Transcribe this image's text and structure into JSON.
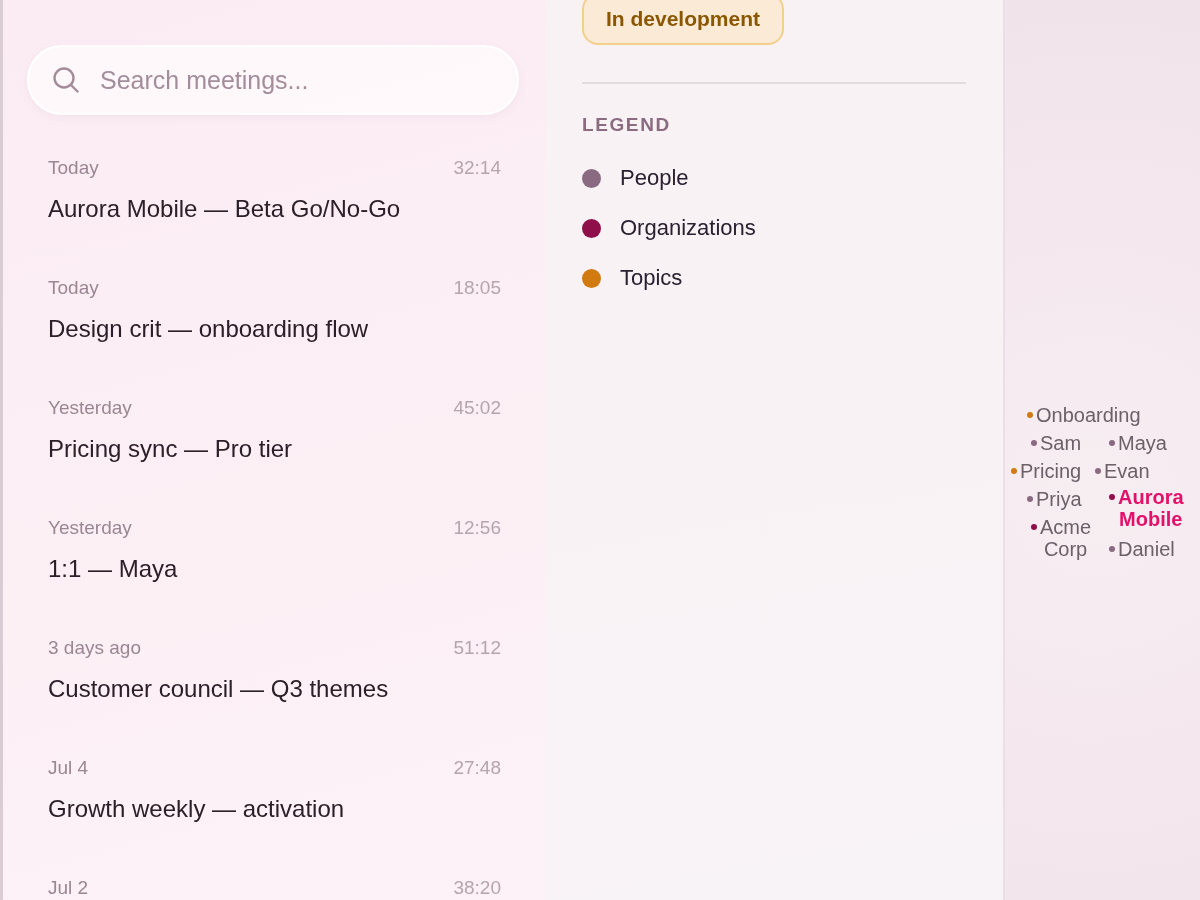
{
  "search": {
    "placeholder": "Search meetings..."
  },
  "meetings": [
    {
      "when": "Today",
      "duration": "32:14",
      "title": "Aurora Mobile — Beta Go/No-Go"
    },
    {
      "when": "Today",
      "duration": "18:05",
      "title": "Design crit — onboarding flow"
    },
    {
      "when": "Yesterday",
      "duration": "45:02",
      "title": "Pricing sync — Pro tier"
    },
    {
      "when": "Yesterday",
      "duration": "12:56",
      "title": "1:1 — Maya"
    },
    {
      "when": "3 days ago",
      "duration": "51:12",
      "title": "Customer council — Q3 themes"
    },
    {
      "when": "Jul 4",
      "duration": "27:48",
      "title": "Growth weekly — activation"
    },
    {
      "when": "Jul 2",
      "duration": "38:20"
    }
  ],
  "details": {
    "status_badge": "In development",
    "legend": {
      "title": "LEGEND",
      "items": [
        {
          "label": "People",
          "kind": "person",
          "color": "#8a6a80"
        },
        {
          "label": "Organizations",
          "kind": "organization",
          "color": "#8e0f4a"
        },
        {
          "label": "Topics",
          "kind": "topic",
          "color": "#d17a10"
        }
      ]
    }
  },
  "graph": {
    "nodes": [
      {
        "label": "Onboarding",
        "kind": "topic",
        "selected": false
      },
      {
        "label": "Sam",
        "kind": "person",
        "selected": false
      },
      {
        "label": "Maya",
        "kind": "person",
        "selected": false
      },
      {
        "label": "Pricing",
        "kind": "topic",
        "selected": false
      },
      {
        "label": "Evan",
        "kind": "person",
        "selected": false
      },
      {
        "label": "Priya",
        "kind": "person",
        "selected": false
      },
      {
        "label": "Aurora Mobile",
        "kind": "organization",
        "selected": true
      },
      {
        "label": "Acme Corp",
        "kind": "organization",
        "selected": false
      },
      {
        "label": "Daniel",
        "kind": "person",
        "selected": false
      }
    ]
  }
}
